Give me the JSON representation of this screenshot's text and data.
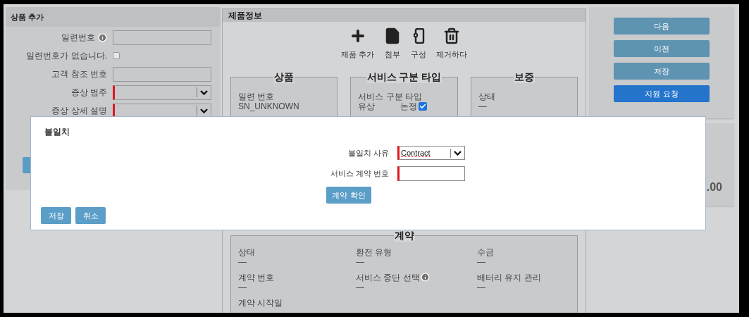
{
  "left_panel": {
    "title": "상품 추가",
    "fields": [
      {
        "kind": "text",
        "label": "일련번호",
        "info": true,
        "required": false
      },
      {
        "kind": "checkbox",
        "label": "일련번호가 없습니다.",
        "checked": false
      },
      {
        "kind": "text",
        "label": "고객 참조 번호",
        "info": false,
        "required": false
      },
      {
        "kind": "select",
        "label": "증상 범주",
        "required": true
      },
      {
        "kind": "select",
        "label": "증상 상세 설명",
        "required": true
      }
    ]
  },
  "product_info": {
    "title": "제품정보",
    "toolbar": [
      {
        "kind": "add",
        "label": "제품 추가"
      },
      {
        "kind": "attach",
        "label": "첨부"
      },
      {
        "kind": "config",
        "label": "구성"
      },
      {
        "kind": "delete",
        "label": "제거하다"
      }
    ],
    "sections": [
      {
        "legend": "상품",
        "items": [
          {
            "label": "일련 번호",
            "value": "SN_UNKNOWN"
          }
        ]
      },
      {
        "legend": "서비스 구분 타입",
        "items": [
          {
            "label": "서비스 구분 타입",
            "options": [
              {
                "label": "유상",
                "kind": "text"
              },
              {
                "label": "논쟁",
                "kind": "checkbox",
                "checked": true
              }
            ]
          }
        ]
      },
      {
        "legend": "보증",
        "items": [
          {
            "label": "상태",
            "value": "—"
          }
        ]
      }
    ],
    "contract": {
      "legend": "계약",
      "items": [
        {
          "label": "상태",
          "value": "—",
          "info": false
        },
        {
          "label": "환전 유형",
          "value": "—",
          "info": false
        },
        {
          "label": "수금",
          "value": "—",
          "info": false
        },
        {
          "label": "계약 번호",
          "value": "—",
          "info": false
        },
        {
          "label": "서비스 중단 선택",
          "value": "—",
          "info": true
        },
        {
          "label": "배터리 유지 관리",
          "value": "—",
          "info": false
        },
        {
          "label": "계약 시작일",
          "info": false
        }
      ]
    }
  },
  "actions": [
    {
      "label": "다음",
      "kind": "secondary"
    },
    {
      "label": "이전",
      "kind": "secondary"
    },
    {
      "label": "저장",
      "kind": "secondary"
    },
    {
      "label": "지원 요청",
      "kind": "primary"
    }
  ],
  "total_card": {
    "amount": ".00"
  },
  "dialog": {
    "title": "불일치",
    "fields": [
      {
        "kind": "select",
        "label": "불일치 사유",
        "value": "Contract",
        "required": true
      },
      {
        "kind": "text",
        "label": "서비스 계약 번호",
        "required": true
      }
    ],
    "verify_button": "계약 확인",
    "buttons": [
      "저장",
      "취소"
    ]
  }
}
